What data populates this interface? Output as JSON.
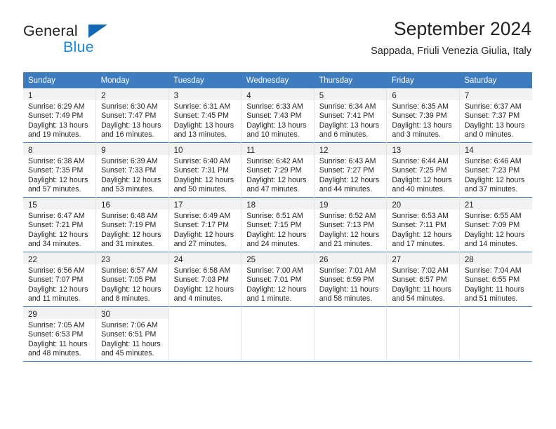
{
  "logo": {
    "word_top": "General",
    "word_bottom": "Blue",
    "triangle_color": "#1268b3",
    "blue_color": "#1c87d6"
  },
  "header": {
    "title": "September 2024",
    "subtitle": "Sappada, Friuli Venezia Giulia, Italy"
  },
  "theme": {
    "header_blue": "#3c7cbf",
    "daynum_bg": "#f2f2f2",
    "text": "#231f20",
    "cell_divider": "#e3e3e3"
  },
  "weekday_headers": [
    "Sunday",
    "Monday",
    "Tuesday",
    "Wednesday",
    "Thursday",
    "Friday",
    "Saturday"
  ],
  "weeks": [
    [
      {
        "day": "1",
        "sunrise": "Sunrise: 6:29 AM",
        "sunset": "Sunset: 7:49 PM",
        "daylight1": "Daylight: 13 hours",
        "daylight2": "and 19 minutes."
      },
      {
        "day": "2",
        "sunrise": "Sunrise: 6:30 AM",
        "sunset": "Sunset: 7:47 PM",
        "daylight1": "Daylight: 13 hours",
        "daylight2": "and 16 minutes."
      },
      {
        "day": "3",
        "sunrise": "Sunrise: 6:31 AM",
        "sunset": "Sunset: 7:45 PM",
        "daylight1": "Daylight: 13 hours",
        "daylight2": "and 13 minutes."
      },
      {
        "day": "4",
        "sunrise": "Sunrise: 6:33 AM",
        "sunset": "Sunset: 7:43 PM",
        "daylight1": "Daylight: 13 hours",
        "daylight2": "and 10 minutes."
      },
      {
        "day": "5",
        "sunrise": "Sunrise: 6:34 AM",
        "sunset": "Sunset: 7:41 PM",
        "daylight1": "Daylight: 13 hours",
        "daylight2": "and 6 minutes."
      },
      {
        "day": "6",
        "sunrise": "Sunrise: 6:35 AM",
        "sunset": "Sunset: 7:39 PM",
        "daylight1": "Daylight: 13 hours",
        "daylight2": "and 3 minutes."
      },
      {
        "day": "7",
        "sunrise": "Sunrise: 6:37 AM",
        "sunset": "Sunset: 7:37 PM",
        "daylight1": "Daylight: 13 hours",
        "daylight2": "and 0 minutes."
      }
    ],
    [
      {
        "day": "8",
        "sunrise": "Sunrise: 6:38 AM",
        "sunset": "Sunset: 7:35 PM",
        "daylight1": "Daylight: 12 hours",
        "daylight2": "and 57 minutes."
      },
      {
        "day": "9",
        "sunrise": "Sunrise: 6:39 AM",
        "sunset": "Sunset: 7:33 PM",
        "daylight1": "Daylight: 12 hours",
        "daylight2": "and 53 minutes."
      },
      {
        "day": "10",
        "sunrise": "Sunrise: 6:40 AM",
        "sunset": "Sunset: 7:31 PM",
        "daylight1": "Daylight: 12 hours",
        "daylight2": "and 50 minutes."
      },
      {
        "day": "11",
        "sunrise": "Sunrise: 6:42 AM",
        "sunset": "Sunset: 7:29 PM",
        "daylight1": "Daylight: 12 hours",
        "daylight2": "and 47 minutes."
      },
      {
        "day": "12",
        "sunrise": "Sunrise: 6:43 AM",
        "sunset": "Sunset: 7:27 PM",
        "daylight1": "Daylight: 12 hours",
        "daylight2": "and 44 minutes."
      },
      {
        "day": "13",
        "sunrise": "Sunrise: 6:44 AM",
        "sunset": "Sunset: 7:25 PM",
        "daylight1": "Daylight: 12 hours",
        "daylight2": "and 40 minutes."
      },
      {
        "day": "14",
        "sunrise": "Sunrise: 6:46 AM",
        "sunset": "Sunset: 7:23 PM",
        "daylight1": "Daylight: 12 hours",
        "daylight2": "and 37 minutes."
      }
    ],
    [
      {
        "day": "15",
        "sunrise": "Sunrise: 6:47 AM",
        "sunset": "Sunset: 7:21 PM",
        "daylight1": "Daylight: 12 hours",
        "daylight2": "and 34 minutes."
      },
      {
        "day": "16",
        "sunrise": "Sunrise: 6:48 AM",
        "sunset": "Sunset: 7:19 PM",
        "daylight1": "Daylight: 12 hours",
        "daylight2": "and 31 minutes."
      },
      {
        "day": "17",
        "sunrise": "Sunrise: 6:49 AM",
        "sunset": "Sunset: 7:17 PM",
        "daylight1": "Daylight: 12 hours",
        "daylight2": "and 27 minutes."
      },
      {
        "day": "18",
        "sunrise": "Sunrise: 6:51 AM",
        "sunset": "Sunset: 7:15 PM",
        "daylight1": "Daylight: 12 hours",
        "daylight2": "and 24 minutes."
      },
      {
        "day": "19",
        "sunrise": "Sunrise: 6:52 AM",
        "sunset": "Sunset: 7:13 PM",
        "daylight1": "Daylight: 12 hours",
        "daylight2": "and 21 minutes."
      },
      {
        "day": "20",
        "sunrise": "Sunrise: 6:53 AM",
        "sunset": "Sunset: 7:11 PM",
        "daylight1": "Daylight: 12 hours",
        "daylight2": "and 17 minutes."
      },
      {
        "day": "21",
        "sunrise": "Sunrise: 6:55 AM",
        "sunset": "Sunset: 7:09 PM",
        "daylight1": "Daylight: 12 hours",
        "daylight2": "and 14 minutes."
      }
    ],
    [
      {
        "day": "22",
        "sunrise": "Sunrise: 6:56 AM",
        "sunset": "Sunset: 7:07 PM",
        "daylight1": "Daylight: 12 hours",
        "daylight2": "and 11 minutes."
      },
      {
        "day": "23",
        "sunrise": "Sunrise: 6:57 AM",
        "sunset": "Sunset: 7:05 PM",
        "daylight1": "Daylight: 12 hours",
        "daylight2": "and 8 minutes."
      },
      {
        "day": "24",
        "sunrise": "Sunrise: 6:58 AM",
        "sunset": "Sunset: 7:03 PM",
        "daylight1": "Daylight: 12 hours",
        "daylight2": "and 4 minutes."
      },
      {
        "day": "25",
        "sunrise": "Sunrise: 7:00 AM",
        "sunset": "Sunset: 7:01 PM",
        "daylight1": "Daylight: 12 hours",
        "daylight2": "and 1 minute."
      },
      {
        "day": "26",
        "sunrise": "Sunrise: 7:01 AM",
        "sunset": "Sunset: 6:59 PM",
        "daylight1": "Daylight: 11 hours",
        "daylight2": "and 58 minutes."
      },
      {
        "day": "27",
        "sunrise": "Sunrise: 7:02 AM",
        "sunset": "Sunset: 6:57 PM",
        "daylight1": "Daylight: 11 hours",
        "daylight2": "and 54 minutes."
      },
      {
        "day": "28",
        "sunrise": "Sunrise: 7:04 AM",
        "sunset": "Sunset: 6:55 PM",
        "daylight1": "Daylight: 11 hours",
        "daylight2": "and 51 minutes."
      }
    ],
    [
      {
        "day": "29",
        "sunrise": "Sunrise: 7:05 AM",
        "sunset": "Sunset: 6:53 PM",
        "daylight1": "Daylight: 11 hours",
        "daylight2": "and 48 minutes."
      },
      {
        "day": "30",
        "sunrise": "Sunrise: 7:06 AM",
        "sunset": "Sunset: 6:51 PM",
        "daylight1": "Daylight: 11 hours",
        "daylight2": "and 45 minutes."
      },
      {
        "day": "",
        "sunrise": "",
        "sunset": "",
        "daylight1": "",
        "daylight2": ""
      },
      {
        "day": "",
        "sunrise": "",
        "sunset": "",
        "daylight1": "",
        "daylight2": ""
      },
      {
        "day": "",
        "sunrise": "",
        "sunset": "",
        "daylight1": "",
        "daylight2": ""
      },
      {
        "day": "",
        "sunrise": "",
        "sunset": "",
        "daylight1": "",
        "daylight2": ""
      },
      {
        "day": "",
        "sunrise": "",
        "sunset": "",
        "daylight1": "",
        "daylight2": ""
      }
    ]
  ]
}
